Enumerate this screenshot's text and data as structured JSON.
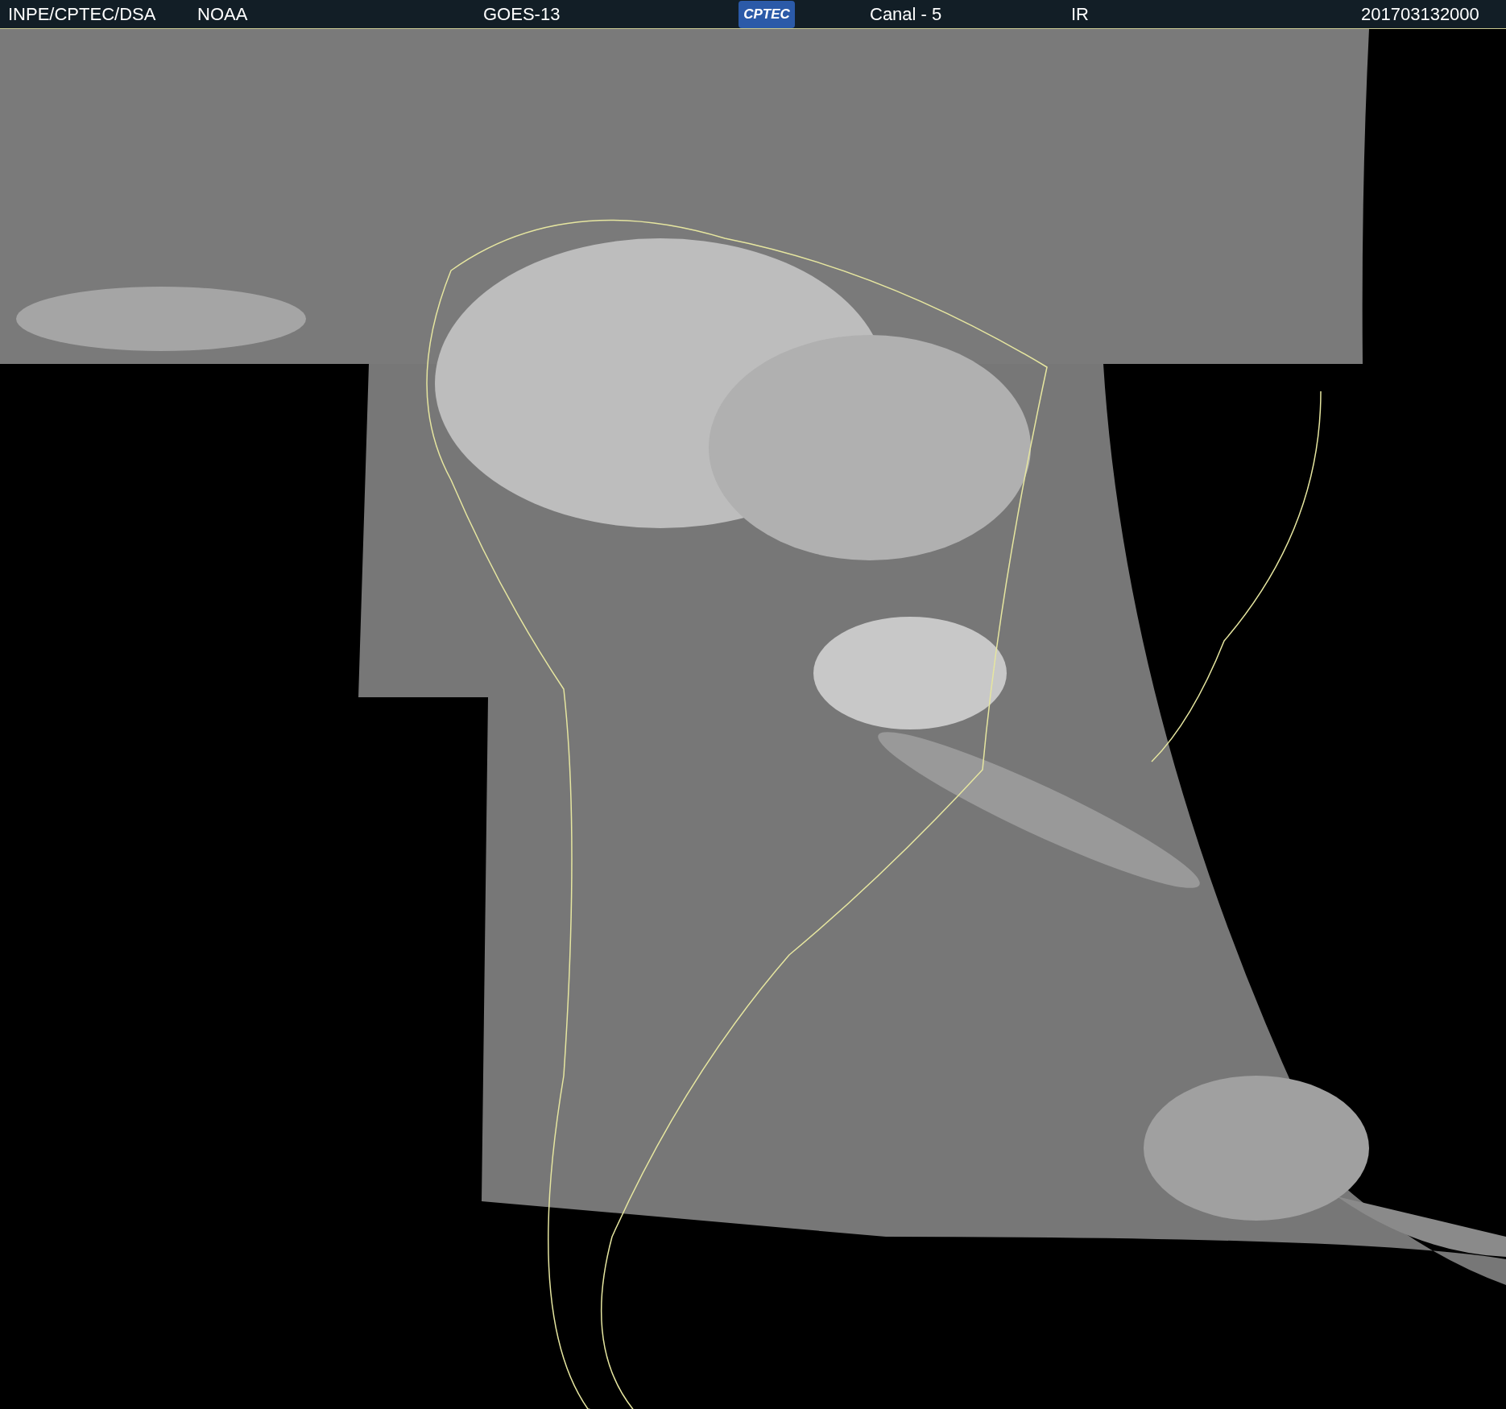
{
  "header": {
    "source": "INPE/CPTEC/DSA",
    "agency": "NOAA",
    "satellite": "GOES-13",
    "logo": "CPTEC",
    "channel": "Canal - 5",
    "band": "IR",
    "timestamp": "201703132000"
  }
}
